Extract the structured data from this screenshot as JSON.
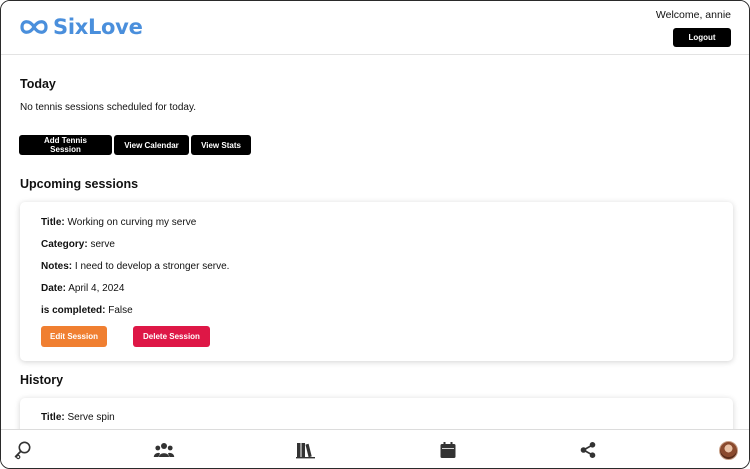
{
  "header": {
    "brand_name": "SixLove",
    "welcome_text": "Welcome, annie",
    "logout_label": "Logout"
  },
  "today": {
    "title": "Today",
    "empty_message": "No tennis sessions scheduled for today."
  },
  "actions": {
    "add_label": "Add Tennis Session",
    "calendar_label": "View Calendar",
    "stats_label": "View Stats"
  },
  "upcoming": {
    "title": "Upcoming sessions",
    "sessions": [
      {
        "title_label": "Title:",
        "title_value": "Working on curving my serve",
        "category_label": "Category:",
        "category_value": "serve",
        "notes_label": "Notes:",
        "notes_value": "I need to develop a stronger serve.",
        "date_label": "Date:",
        "date_value": "April 4, 2024",
        "completed_label": "is completed:",
        "completed_value": "False",
        "edit_label": "Edit Session",
        "delete_label": "Delete Session"
      }
    ]
  },
  "history": {
    "title": "History",
    "sessions": [
      {
        "title_label": "Title:",
        "title_value": "Serve spin"
      }
    ]
  },
  "bottom_nav": {
    "icons": [
      "racket-icon",
      "people-icon",
      "library-icon",
      "calendar-icon",
      "share-icon",
      "avatar"
    ]
  },
  "colors": {
    "brand": "#4a8fdc",
    "edit": "#f07f31",
    "delete": "#de1746",
    "primary_button": "#000000",
    "nav_icon": "#333333"
  }
}
